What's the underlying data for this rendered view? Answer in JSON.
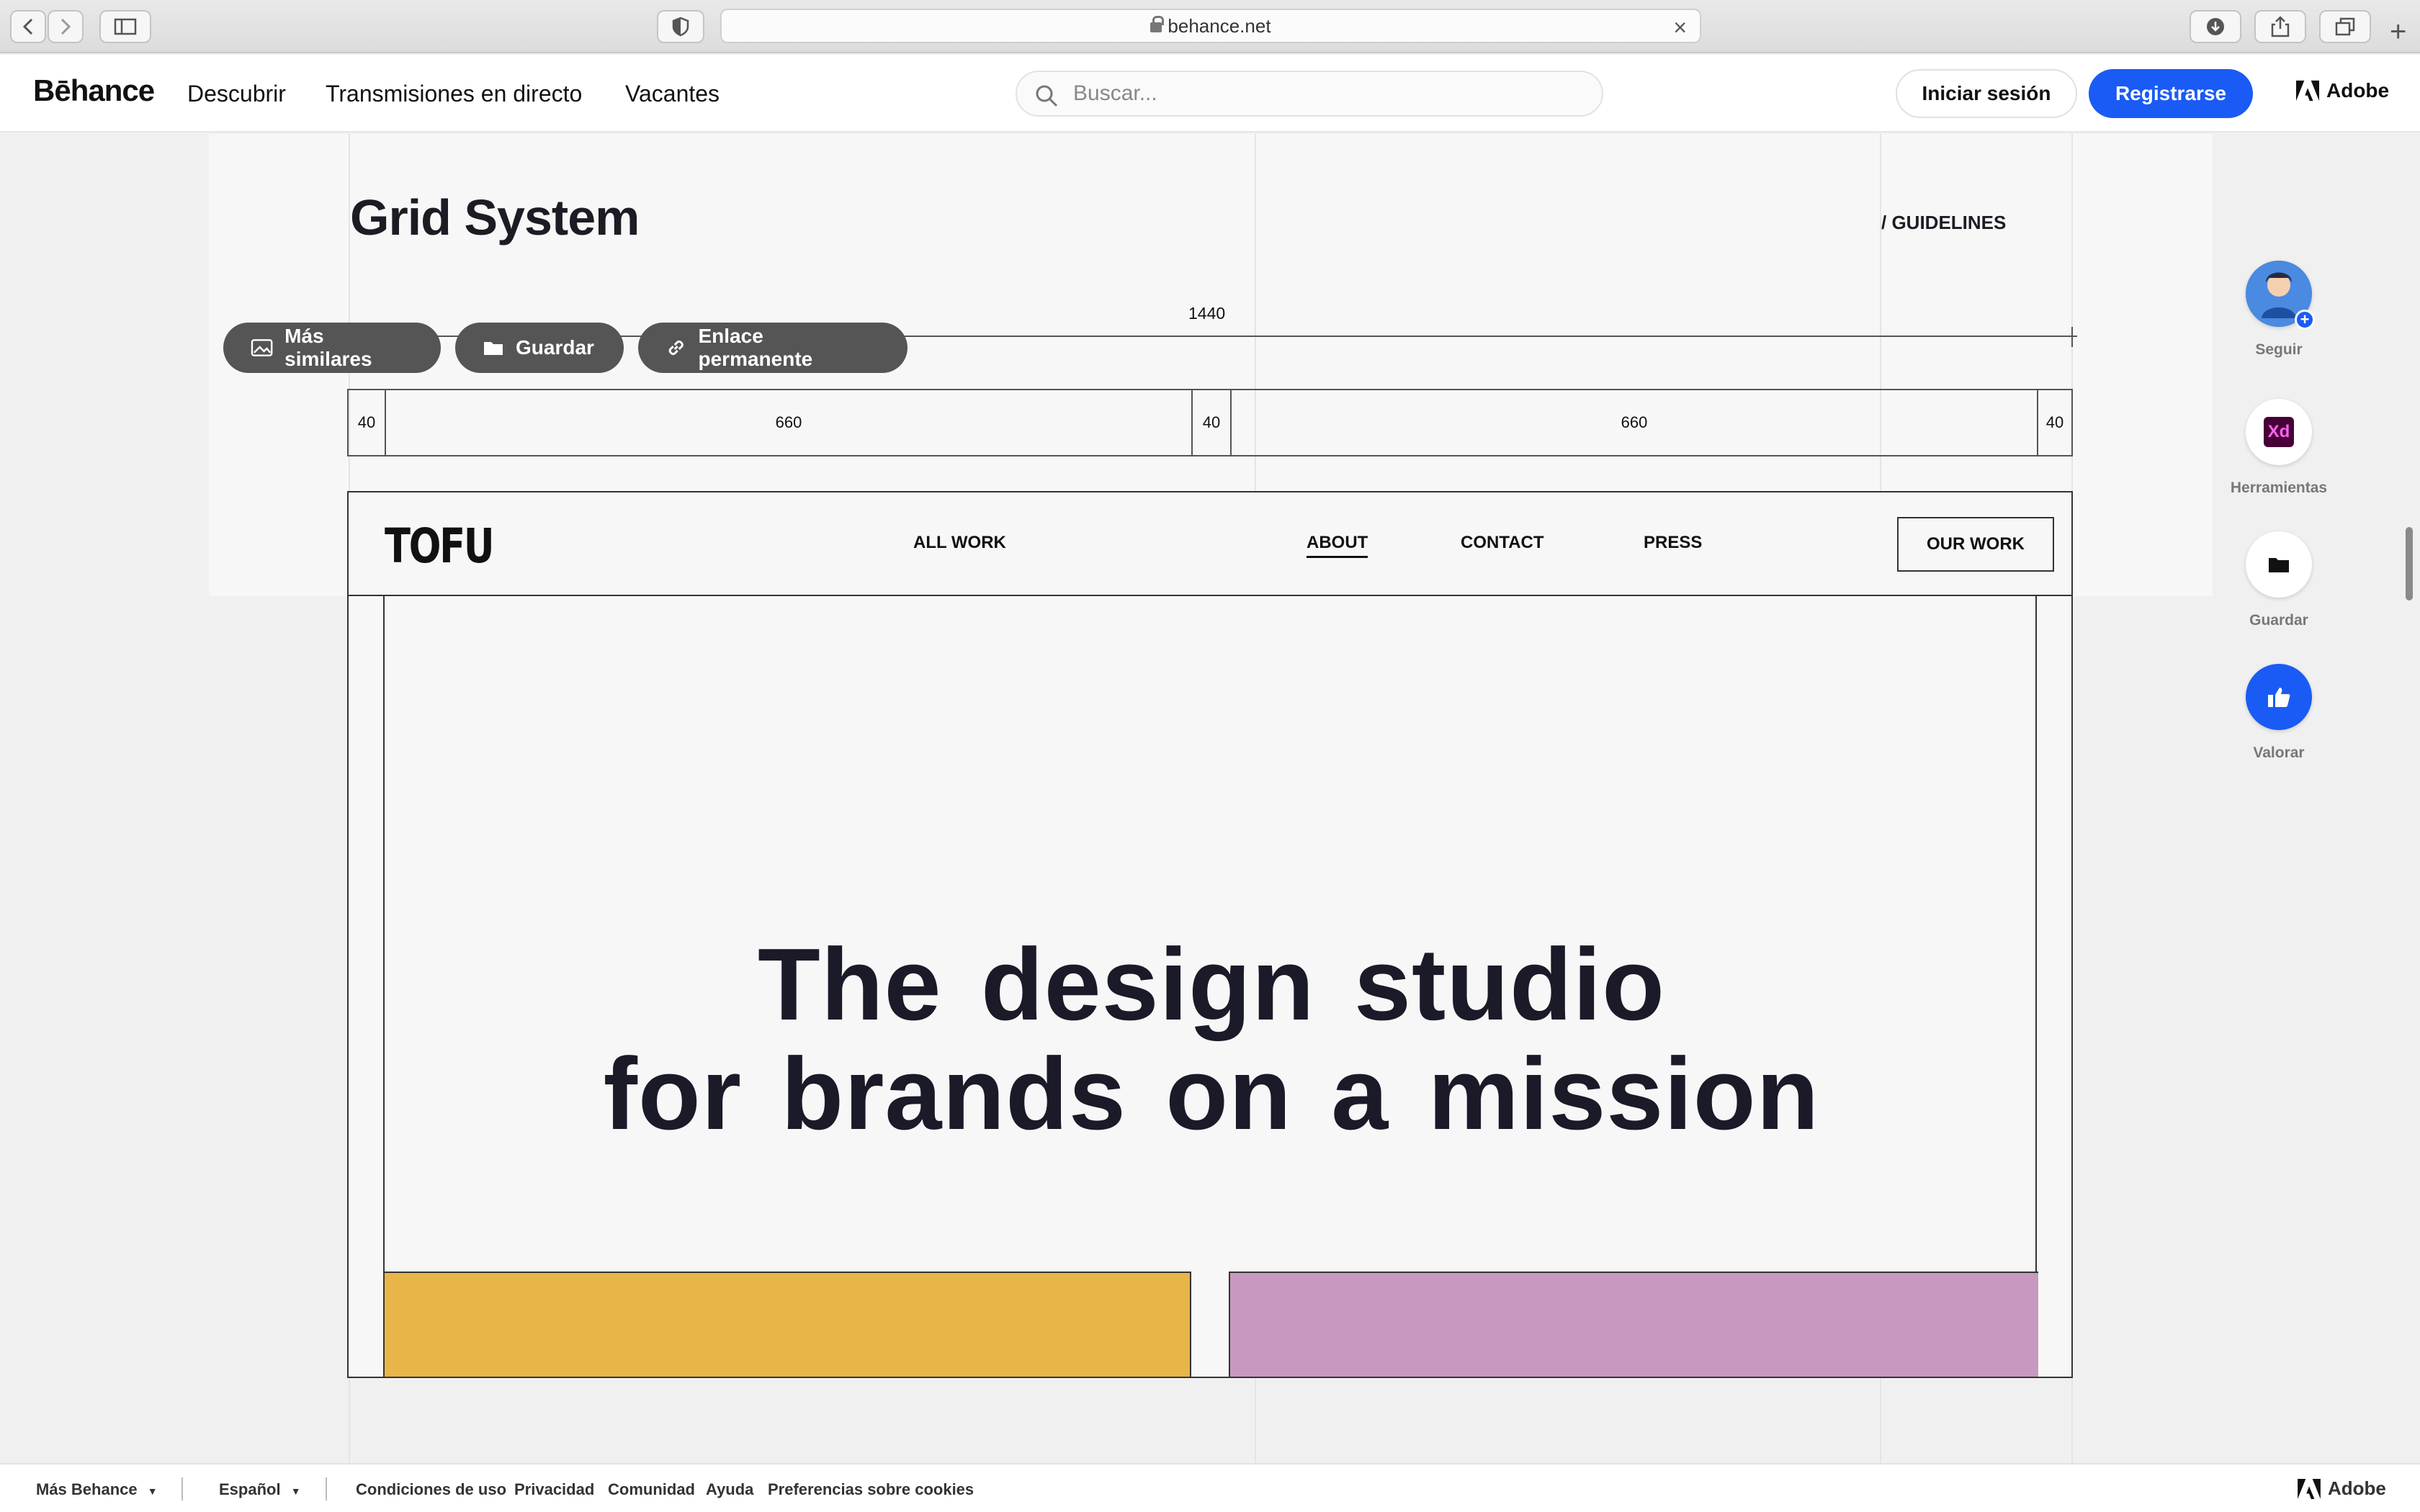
{
  "browser": {
    "url": "behance.net",
    "icons": [
      "back-icon",
      "forward-icon",
      "sidebar-icon",
      "shield-icon",
      "download-icon",
      "share-icon",
      "tabs-icon",
      "new-tab-icon"
    ]
  },
  "header": {
    "logo": "Bēhance",
    "nav": [
      "Descubrir",
      "Transmisiones en directo",
      "Vacantes"
    ],
    "search_placeholder": "Buscar...",
    "signin": "Iniciar sesión",
    "register": "Registrarse",
    "adobe": "Adobe",
    "accent": "#1a5bf5"
  },
  "project": {
    "title": "Grid System",
    "section": "/ GUIDELINES",
    "ruler_total": "1440",
    "columns": [
      "40",
      "660",
      "40",
      "660",
      "40"
    ],
    "actions": [
      "Más similares",
      "Guardar",
      "Enlace permanente"
    ],
    "mock": {
      "logo": "TOFU",
      "nav": [
        "ALL WORK",
        "ABOUT",
        "CONTACT",
        "PRESS"
      ],
      "active_nav": "ABOUT",
      "cta": "OUR WORK",
      "hero_line1": "The design studio",
      "hero_line2": "for brands on a mission",
      "block_colors": [
        "#e8b548",
        "#c899c0"
      ]
    }
  },
  "rail": {
    "follow": "Seguir",
    "tools": "Herramientas",
    "tool_badge": "Xd",
    "save": "Guardar",
    "appreciate": "Valorar"
  },
  "footer": {
    "more": "Más Behance",
    "language": "Español",
    "links": [
      "Condiciones de uso",
      "Privacidad",
      "Comunidad",
      "Ayuda",
      "Preferencias sobre cookies"
    ],
    "adobe": "Adobe"
  }
}
